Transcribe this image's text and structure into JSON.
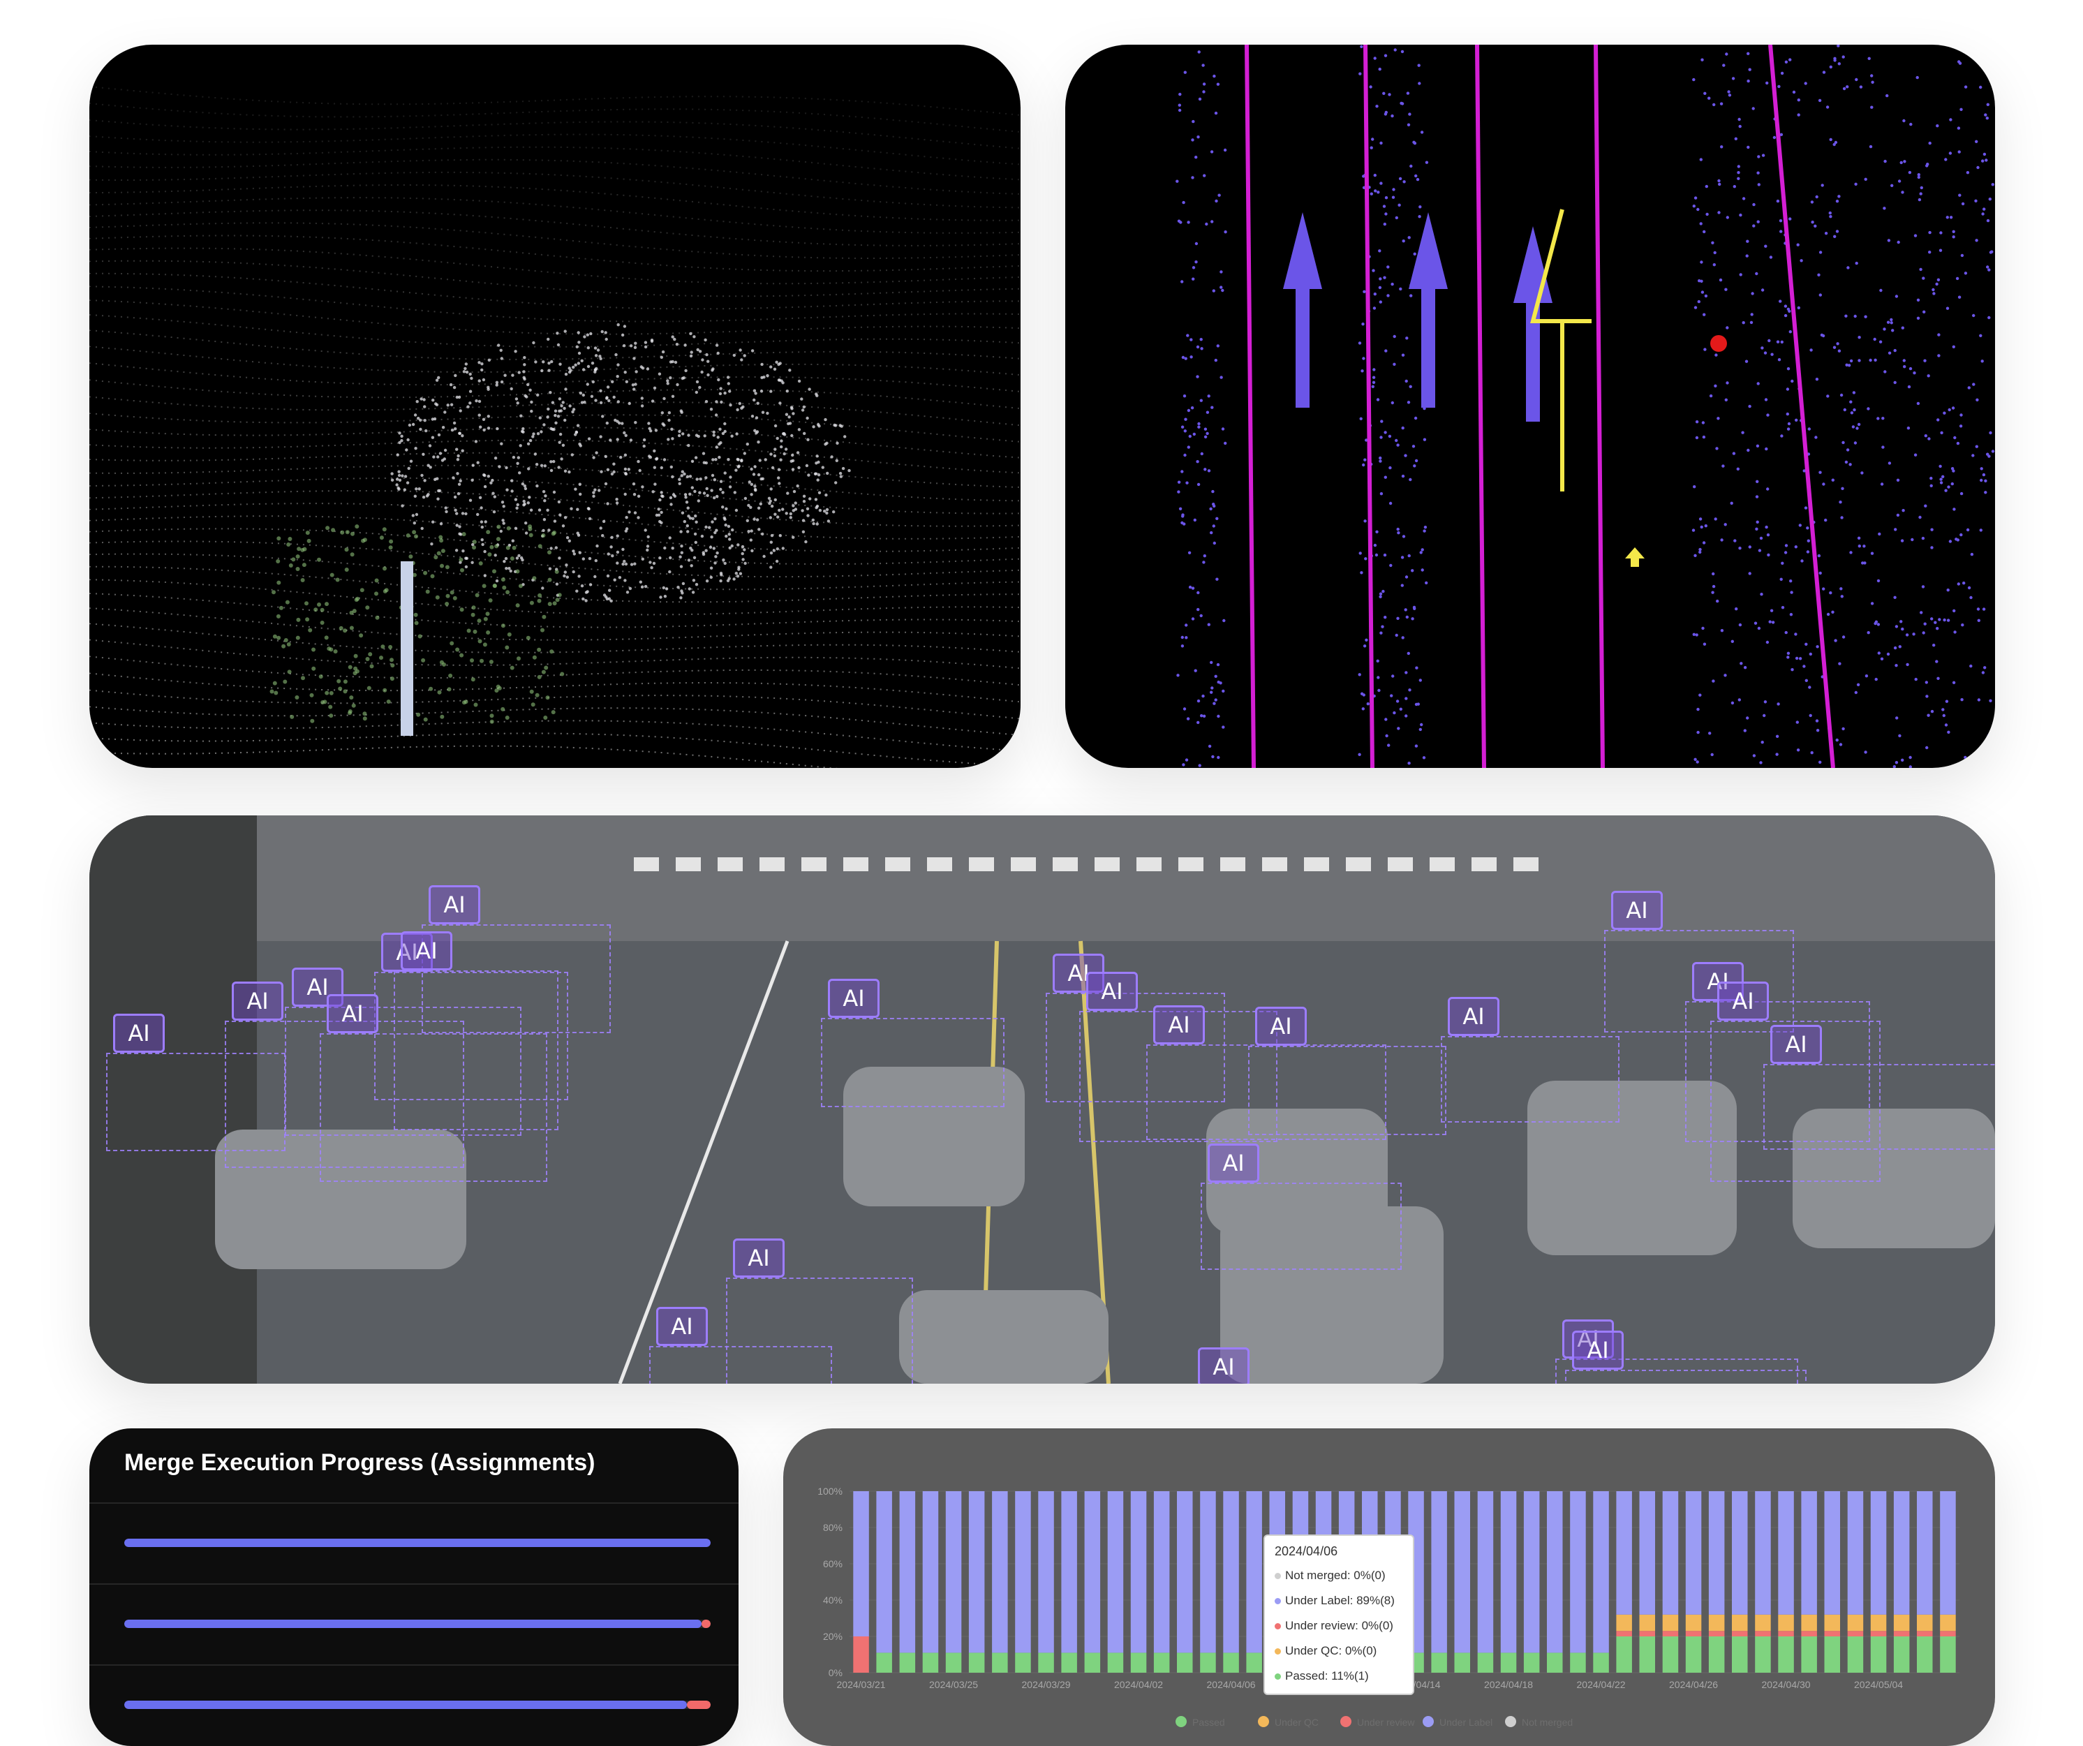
{
  "merge_panel": {
    "title": "Merge Execution Progress (Assignments)",
    "rows": [
      {
        "passed_fraction": 1.0,
        "failed_fraction": 0.0
      },
      {
        "passed_fraction": 0.985,
        "failed_fraction": 0.015
      },
      {
        "passed_fraction": 0.96,
        "failed_fraction": 0.04
      }
    ],
    "colors": {
      "progress": "#6a6ff0",
      "failed": "#f26a6a"
    }
  },
  "traffic_panel": {
    "tag_label": "AI",
    "tag_count": 29,
    "colors": {
      "tag_border": "#9d7dff",
      "box": "#a082ff"
    }
  },
  "lidar_panels": {
    "pointcloud": {
      "icon": "car-pointcloud-icon"
    },
    "lanes": {
      "icon": "lane-arrow-icon",
      "colors": {
        "lane_line": "#d41fd4",
        "points": "#6b55e8",
        "selection": "#f4e84a",
        "anchor": "#e41a1a"
      }
    }
  },
  "chart_data": {
    "type": "bar",
    "stacked": true,
    "y_ticks": [
      "0%",
      "20%",
      "40%",
      "60%",
      "80%",
      "100%"
    ],
    "ylim": [
      0,
      100
    ],
    "x_tick_labels": [
      "2024/03/21",
      "2024/03/25",
      "2024/03/29",
      "2024/04/02",
      "2024/04/06",
      "2024/04/10",
      "2024/04/14",
      "2024/04/18",
      "2024/04/22",
      "2024/04/26",
      "2024/04/30",
      "2024/05/04"
    ],
    "bar_count": 48,
    "series": [
      {
        "name": "Passed",
        "color": "#7fd37f",
        "values": [
          0,
          11,
          11,
          11,
          11,
          11,
          11,
          11,
          11,
          11,
          11,
          11,
          11,
          11,
          11,
          11,
          11,
          11,
          11,
          11,
          11,
          11,
          11,
          11,
          11,
          11,
          11,
          11,
          11,
          11,
          11,
          11,
          11,
          11,
          11,
          11,
          11,
          11,
          11,
          11,
          11,
          11,
          11,
          11,
          11,
          11,
          11,
          11
        ]
      },
      {
        "name": "Under QC",
        "color": "#f3b85a",
        "values": [
          0,
          0,
          0,
          0,
          0,
          0,
          0,
          0,
          0,
          0,
          0,
          0,
          0,
          0,
          0,
          0,
          0,
          0,
          0,
          0,
          0,
          0,
          0,
          0,
          0,
          0,
          0,
          0,
          0,
          0,
          0,
          0,
          0,
          0,
          0,
          0,
          0,
          0,
          0,
          0,
          0,
          0,
          0,
          0,
          0,
          0,
          0,
          0
        ]
      },
      {
        "name": "Under review",
        "color": "#f07272",
        "values": [
          20,
          0,
          0,
          0,
          0,
          0,
          0,
          0,
          0,
          0,
          0,
          0,
          0,
          0,
          0,
          0,
          0,
          0,
          0,
          0,
          0,
          0,
          0,
          0,
          0,
          0,
          0,
          0,
          0,
          0,
          0,
          0,
          0,
          0,
          0,
          0,
          0,
          0,
          0,
          0,
          0,
          0,
          0,
          0,
          0,
          0,
          0,
          0
        ]
      },
      {
        "name": "Under Label",
        "color": "#9b9cf4",
        "values": [
          80,
          89,
          89,
          89,
          89,
          89,
          89,
          89,
          89,
          89,
          89,
          89,
          89,
          89,
          89,
          89,
          89,
          89,
          89,
          89,
          89,
          89,
          89,
          89,
          89,
          89,
          89,
          89,
          89,
          89,
          89,
          89,
          89,
          89,
          89,
          89,
          89,
          89,
          89,
          89,
          89,
          89,
          89,
          89,
          89,
          89,
          89,
          89
        ]
      },
      {
        "name": "Not merged",
        "color": "#cfcfcf",
        "values": [
          0,
          0,
          0,
          0,
          0,
          0,
          0,
          0,
          0,
          0,
          0,
          0,
          0,
          0,
          0,
          0,
          0,
          0,
          0,
          0,
          0,
          0,
          0,
          0,
          0,
          0,
          0,
          0,
          0,
          0,
          0,
          0,
          0,
          0,
          0,
          0,
          0,
          0,
          0,
          0,
          0,
          0,
          0,
          0,
          0,
          0,
          0,
          0
        ]
      }
    ],
    "late_overrides": {
      "from_bar": 33,
      "passed": 20,
      "under_review": 3,
      "under_qc": 9,
      "under_label": 68
    },
    "tooltip": {
      "date": "2024/04/06",
      "rows": [
        {
          "label": "Not merged: 0%(0)",
          "color": "#cfcfcf"
        },
        {
          "label": "Under Label: 89%(8)",
          "color": "#9b9cf4"
        },
        {
          "label": "Under review: 0%(0)",
          "color": "#f07272"
        },
        {
          "label": "Under QC: 0%(0)",
          "color": "#f3b85a"
        },
        {
          "label": "Passed: 11%(1)",
          "color": "#7fd37f"
        }
      ]
    },
    "legend_placement": "bottom",
    "legend": [
      {
        "label": "Passed",
        "color": "#7fd37f"
      },
      {
        "label": "Under QC",
        "color": "#f3b85a"
      },
      {
        "label": "Under review",
        "color": "#f07272"
      },
      {
        "label": "Under Label",
        "color": "#9b9cf4"
      },
      {
        "label": "Not merged",
        "color": "#cfcfcf"
      }
    ]
  }
}
